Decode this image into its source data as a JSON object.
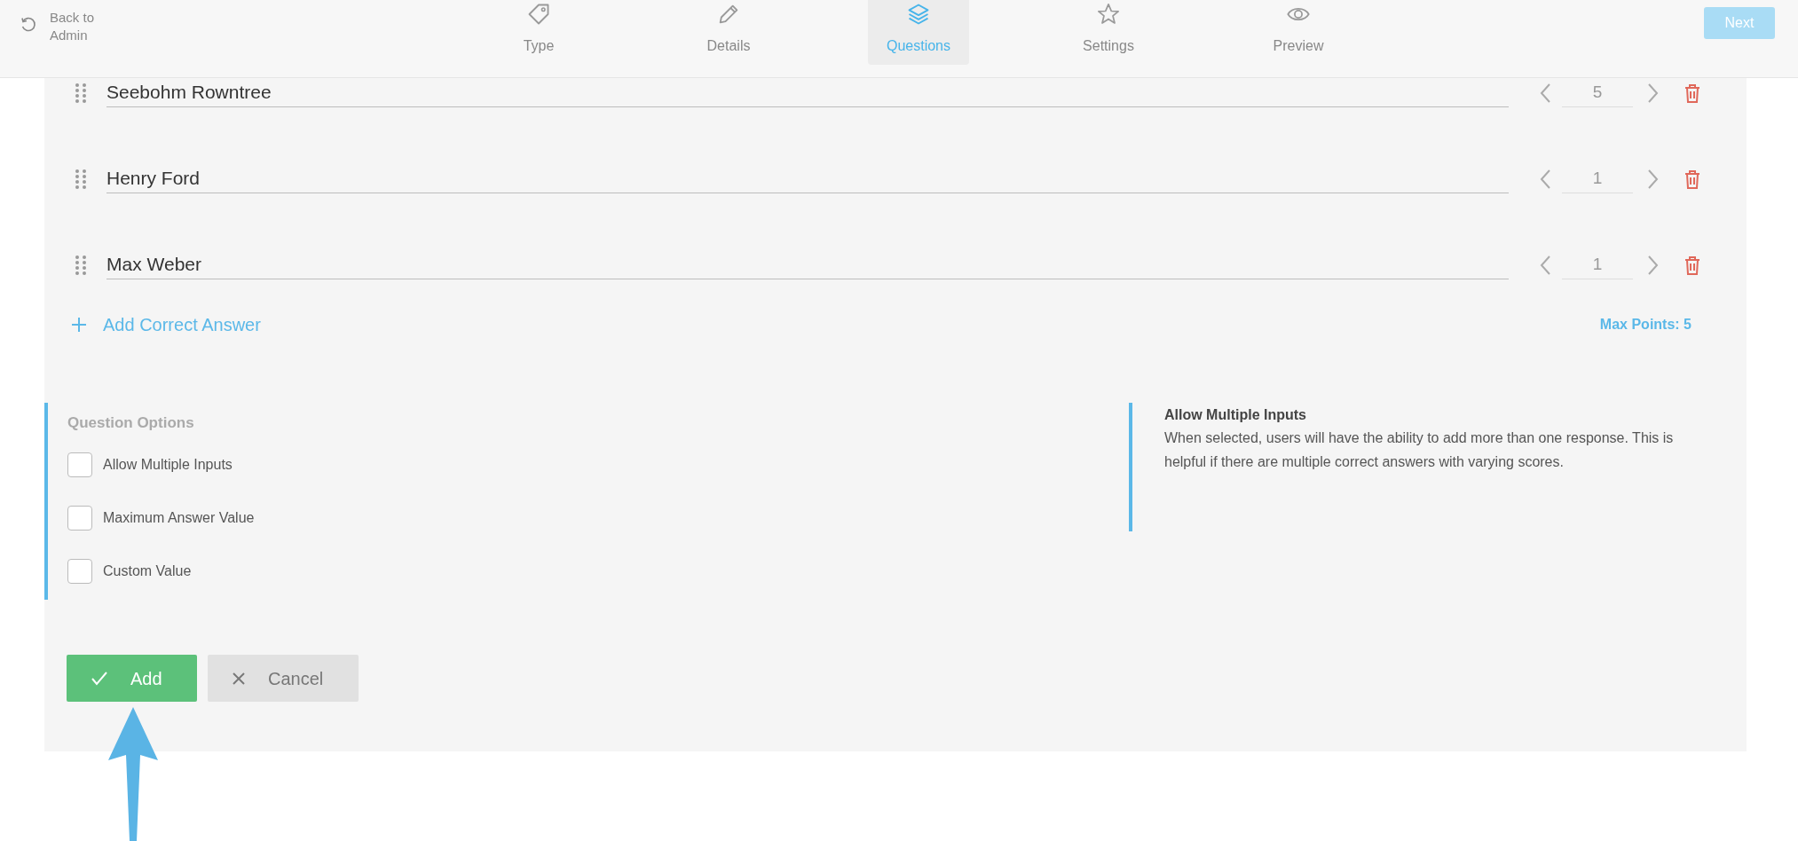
{
  "header": {
    "back_link": "Back to Admin",
    "tabs": [
      {
        "label": "Type",
        "selected": false
      },
      {
        "label": "Details",
        "selected": false
      },
      {
        "label": "Questions",
        "selected": true
      },
      {
        "label": "Settings",
        "selected": false
      },
      {
        "label": "Preview",
        "selected": false
      }
    ],
    "next_button": {
      "label": "Next",
      "disabled": true
    }
  },
  "answers": [
    {
      "text": "Seebohm Rowntree",
      "points": "5"
    },
    {
      "text": "Henry Ford",
      "points": "1"
    },
    {
      "text": "Max Weber",
      "points": "1"
    }
  ],
  "add_answer": "Add Correct Answer",
  "max_points": "Max Points: 5",
  "question_options": {
    "title": "Question Options",
    "options": [
      {
        "label": "Allow Multiple Inputs",
        "checked": false
      },
      {
        "label": "Maximum Answer Value",
        "checked": false
      },
      {
        "label": "Custom Value",
        "checked": false
      }
    ]
  },
  "help": {
    "title": "Allow Multiple Inputs",
    "text": "When selected, users will have the ability to add more than one response. This is helpful if there are multiple correct answers with varying scores."
  },
  "buttons": [
    {
      "label": "Add",
      "kind": "primary"
    },
    {
      "label": "Cancel",
      "kind": "secondary"
    }
  ]
}
